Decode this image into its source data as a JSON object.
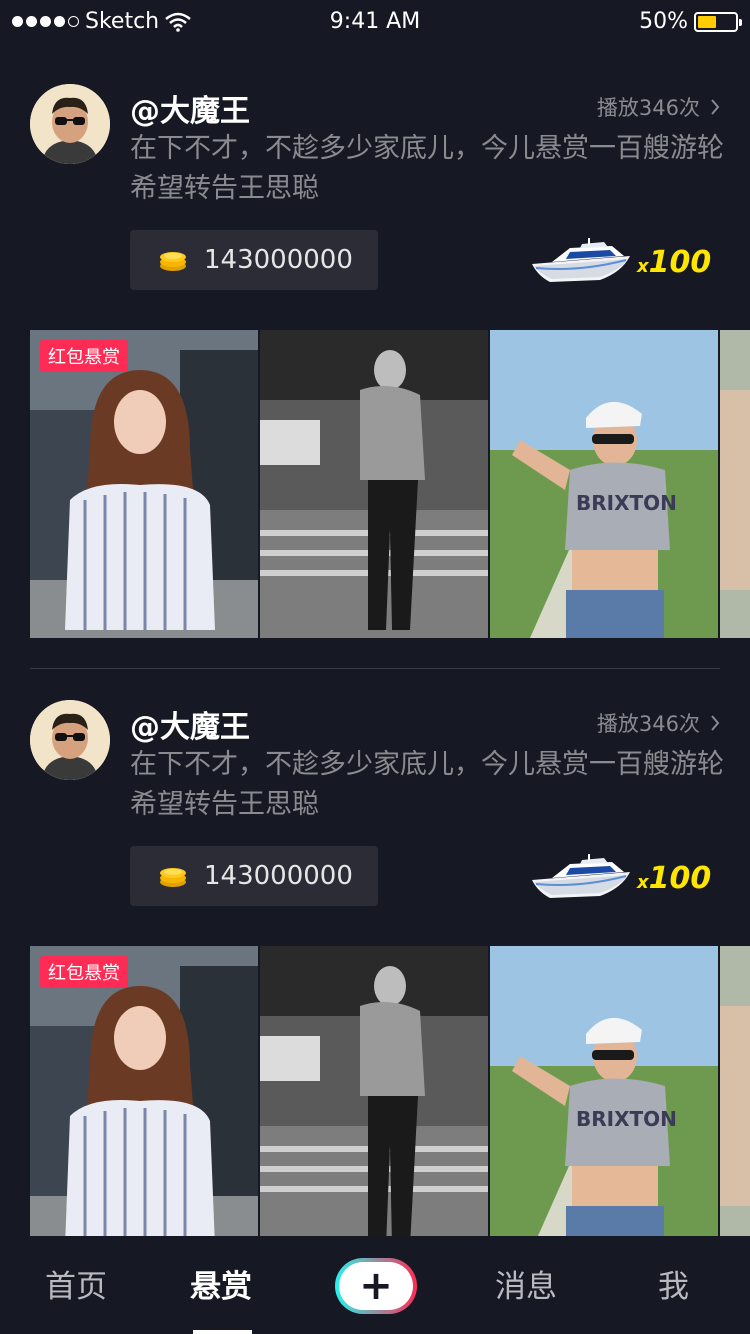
{
  "status_bar": {
    "carrier": "Sketch",
    "time": "9:41 AM",
    "battery": "50%",
    "battery_level": 0.5
  },
  "posts": [
    {
      "username": "@大魔王",
      "plays": "播放346次",
      "description": "在下不才，不趁多少家底儿，今儿悬赏一百艘游轮希望转告王思聪",
      "coins": "143000000",
      "gift_multiplier_prefix": "x",
      "gift_multiplier": "100",
      "badge": "红包悬赏",
      "gift_icon": "yacht-icon"
    },
    {
      "username": "@大魔王",
      "plays": "播放346次",
      "description": "在下不才，不趁多少家底儿，今儿悬赏一百艘游轮希望转告王思聪",
      "coins": "143000000",
      "gift_multiplier_prefix": "x",
      "gift_multiplier": "100",
      "badge": "红包悬赏",
      "gift_icon": "yacht-icon"
    }
  ],
  "tabbar": {
    "home": "首页",
    "reward": "悬赏",
    "add": "+",
    "messages": "消息",
    "me": "我"
  },
  "colors": {
    "background": "#161823",
    "accent_yellow": "#ffe600",
    "badge_red": "#fe2c55",
    "muted_text": "#8a8b91"
  }
}
